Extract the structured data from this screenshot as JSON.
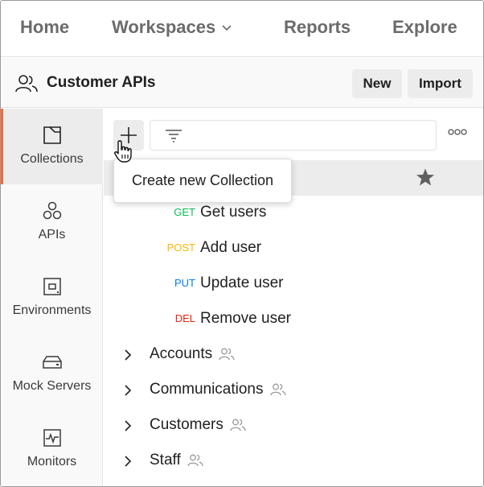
{
  "topnav": {
    "home": "Home",
    "workspaces": "Workspaces",
    "reports": "Reports",
    "explore": "Explore"
  },
  "workspace": {
    "title": "Customer APIs",
    "new_label": "New",
    "import_label": "Import"
  },
  "sidebar": {
    "items": [
      {
        "label": "Collections",
        "icon": "collection-icon",
        "active": true
      },
      {
        "label": "APIs",
        "icon": "apis-icon"
      },
      {
        "label": "Environments",
        "icon": "environment-icon"
      },
      {
        "label": "Mock Servers",
        "icon": "server-icon"
      },
      {
        "label": "Monitors",
        "icon": "monitor-icon"
      }
    ]
  },
  "tooltip": "Create new Collection",
  "requests": [
    {
      "method": "GET",
      "name": "Get users",
      "color": "#0cbb52"
    },
    {
      "method": "POST",
      "name": "Add user",
      "color": "#ffb400"
    },
    {
      "method": "PUT",
      "name": "Update user",
      "color": "#097bed"
    },
    {
      "method": "DEL",
      "name": "Remove user",
      "color": "#eb2013"
    }
  ],
  "collections": [
    {
      "name": "Accounts"
    },
    {
      "name": "Communications"
    },
    {
      "name": "Customers"
    },
    {
      "name": "Staff"
    }
  ],
  "colors": {
    "accent": "#f26b3a",
    "selected_bg": "#ececec",
    "muted_text": "#6b6b6b"
  }
}
